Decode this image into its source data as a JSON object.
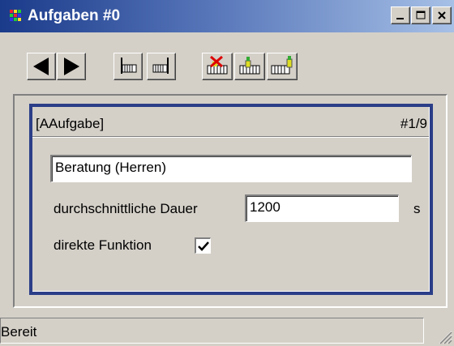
{
  "window": {
    "title": "Aufgaben #0"
  },
  "toolbar": {
    "buttons": [
      {
        "icon": "arrow-left-icon"
      },
      {
        "icon": "arrow-right-icon"
      },
      {
        "icon": "table-first-icon"
      },
      {
        "icon": "table-last-icon"
      },
      {
        "icon": "delete-record-icon"
      },
      {
        "icon": "edit-record-icon"
      },
      {
        "icon": "new-record-icon"
      }
    ]
  },
  "panel": {
    "header_left": "[AAufgabe]",
    "header_right": "#1/9",
    "name_value": "Beratung (Herren)",
    "duration_label": "durchschnittliche Dauer",
    "duration_value": "1200",
    "duration_unit": "s",
    "direct_label": "direkte Funktion",
    "direct_checked": true
  },
  "statusbar": {
    "text": "Bereit"
  },
  "colors": {
    "title_gradient_start": "#1a3a8a",
    "title_gradient_end": "#a6c0e6",
    "panel_border": "#2b3e88",
    "face": "#d4d0c8"
  }
}
